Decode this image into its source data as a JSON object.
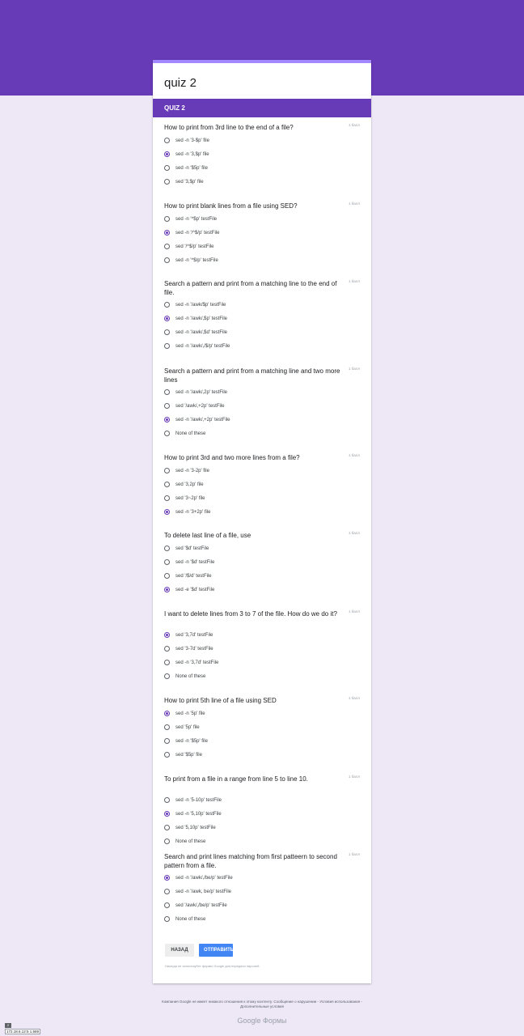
{
  "form": {
    "title": "quiz 2",
    "section_title": "QUIZ 2",
    "points_label": "1 балл",
    "questions": [
      {
        "title": "How to print from 3rd line to the end of a file?",
        "options": [
          "sed -n '3-$p' file",
          "sed -n '3,$p' file",
          "sed -n '$5p' file",
          "sed '3,$p' file"
        ],
        "selected": 1
      },
      {
        "title": "How to print blank lines from a file using SED?",
        "options": [
          "sed -n '^$p' testFile",
          "sed -n '/^$/p' testFile",
          "sed '/^$/p' testFile",
          "sed -n '^$/p' testFile"
        ],
        "selected": 1
      },
      {
        "title": "Search a pattern and print from a matching line to the end of file.",
        "options": [
          "sed -n '/awk/$p' testFile",
          "sed -n '/awk/,$p' testFile",
          "sed -n '/awk/,$d' testFile",
          "sed -n '/awk/,/$/p' testFile"
        ],
        "selected": 1
      },
      {
        "title": "Search a pattern and print from a matching line and two more lines",
        "options": [
          "sed -n '/awk/,2p' testFile",
          "sed '/awk/,+2p' testFile",
          "sed -n '/awk/,+2p' testFile",
          "None of these"
        ],
        "selected": 2
      },
      {
        "title": "How to print 3rd and two more lines from a file?",
        "options": [
          "sed -n '3-2p' file",
          "sed '3,2p' file",
          "sed '3~2p' file",
          "sed -n '3+2p' file"
        ],
        "selected": 3
      },
      {
        "title": "To delete last line of a file, use",
        "options": [
          "sed '$d' testFile",
          "sed -n '$d' testFile",
          "sed '/$/d' testFile",
          "sed -e '$d' testFile"
        ],
        "selected": 3
      },
      {
        "title": "I want to delete lines from 3 to 7 of the file. How do we do it?",
        "options": [
          "sed '3,7d' testFile",
          "sed '3-7d' testFile",
          "sed -n '3,7d' testFile",
          "None of these"
        ],
        "selected": 0
      },
      {
        "title": "How to print 5th line of a file using SED",
        "options": [
          "sed -n '5p' file",
          "sed '5p' file",
          "sed -n '$5p' file",
          "sed '$5p' file"
        ],
        "selected": 0
      },
      {
        "title": "To print from a file in a range from line 5 to line 10.",
        "options": [
          "sed -n '5-10p' testFile",
          "sed -n '5,10p' testFile",
          "sed '5,10p' testFile",
          "None of these"
        ],
        "selected": 1
      },
      {
        "title": "Search and print lines matching from first patteern to second pattern from a file.",
        "options": [
          "sed -n '/awk/,/be/p' testFile",
          "sed -n '/awk, be/p' testFile",
          "sed '/awk/,/be/p' testFile",
          "None of these"
        ],
        "selected": 0
      }
    ],
    "back_label": "НАЗАД",
    "submit_label": "ОТПРАВИТЬ",
    "password_warning": "Никогда не используйте формы Google для передачи паролей."
  },
  "footer": {
    "disclaimer": "Компания Google не имеет никакого отношения к этому контенту.",
    "report_link": "Сообщение о нарушении",
    "terms_link": "Условия использования",
    "extra_terms_link": "Дополнительные условия",
    "brand": "Google Формы"
  },
  "corner": {
    "badge": "2",
    "ip": "172.18.6.12:5 1.569"
  },
  "colors": {
    "accent": "#673ab7",
    "background": "#ede7f6",
    "submit": "#4285f4"
  }
}
